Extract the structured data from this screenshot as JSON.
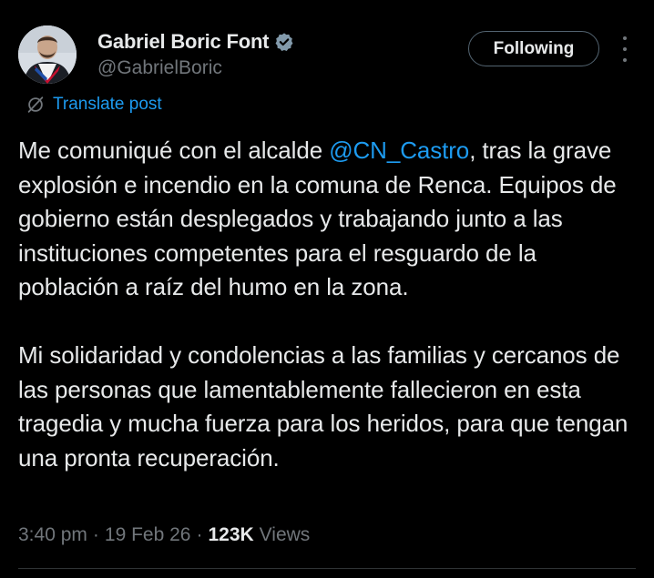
{
  "author": {
    "display_name": "Gabriel Boric Font",
    "handle": "@GabrielBoric",
    "verified": true
  },
  "follow_button": {
    "label": "Following"
  },
  "more_menu": {
    "icon": "more-vertical-icon"
  },
  "translate": {
    "label": "Translate post",
    "icon": "translate-icon"
  },
  "post": {
    "p1_before": "Me comuniqué con el alcalde ",
    "mention": "@CN_Castro",
    "p1_after": ", tras la grave explosión e incendio en la comuna de Renca. Equipos de gobierno están desplegados y trabajando junto a las instituciones competentes para el resguardo de la población a raíz del humo en la zona.",
    "p2": "Mi solidaridad y condolencias a las familias y cercanos de las personas que lamentablemente fallecieron en esta tragedia y mucha fuerza para los heridos, para que tengan una pronta recuperación."
  },
  "meta": {
    "time": "3:40 pm",
    "separator": "·",
    "date": "19 Feb 26",
    "views_count": "123K",
    "views_label": "Views"
  },
  "colors": {
    "background": "#000000",
    "text": "#e7e9ea",
    "secondary": "#71767b",
    "accent": "#1d9bf0",
    "border": "#2f3336"
  }
}
